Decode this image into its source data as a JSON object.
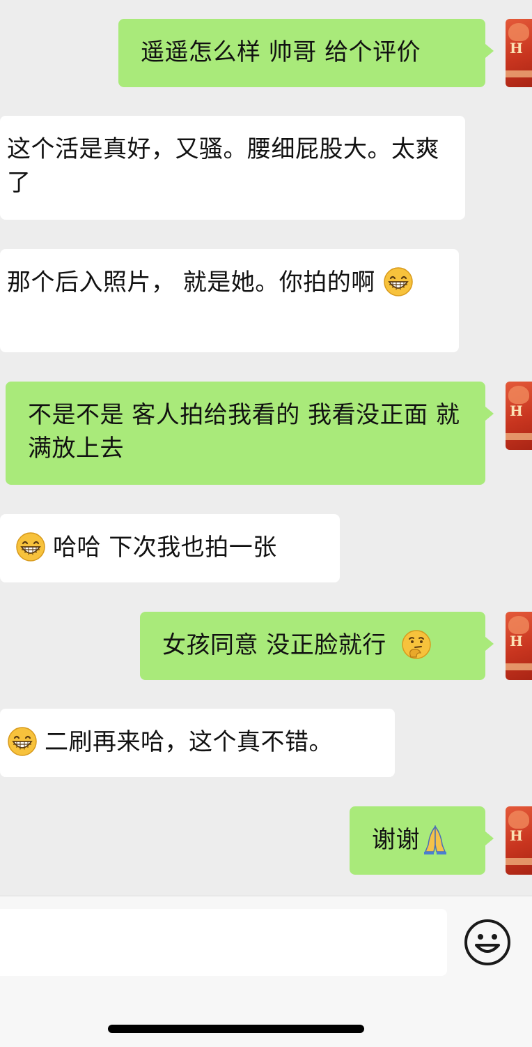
{
  "messages": [
    {
      "side": "out",
      "text": "遥遥怎么样 帅哥 给个评价"
    },
    {
      "side": "in",
      "text": "这个活是真好，又骚。腰细屁股大。太爽了"
    },
    {
      "side": "in",
      "text": "那个后入照片， 就是她。你拍的啊",
      "emoji_after": "grin-emoji"
    },
    {
      "side": "out",
      "text": "不是不是 客人拍给我看的 我看没正面 就满放上去"
    },
    {
      "side": "in",
      "emoji_before": "grin-emoji",
      "text": "哈哈 下次我也拍一张"
    },
    {
      "side": "out",
      "text": "女孩同意 没正脸就行",
      "emoji_after": "thinking-emoji"
    },
    {
      "side": "in",
      "emoji_before": "grin-emoji",
      "text": "二刷再来哈，这个真不错。"
    },
    {
      "side": "out",
      "text": "谢谢",
      "emoji_after": "pray-emoji"
    }
  ],
  "avatar_letter": "H",
  "input": {
    "value": "",
    "emoji_button_icon": "smiley-face-icon"
  },
  "colors": {
    "background": "#ededed",
    "outgoing_bubble": "#a9ea7a",
    "incoming_bubble": "#ffffff",
    "input_bar": "#f7f7f7"
  }
}
